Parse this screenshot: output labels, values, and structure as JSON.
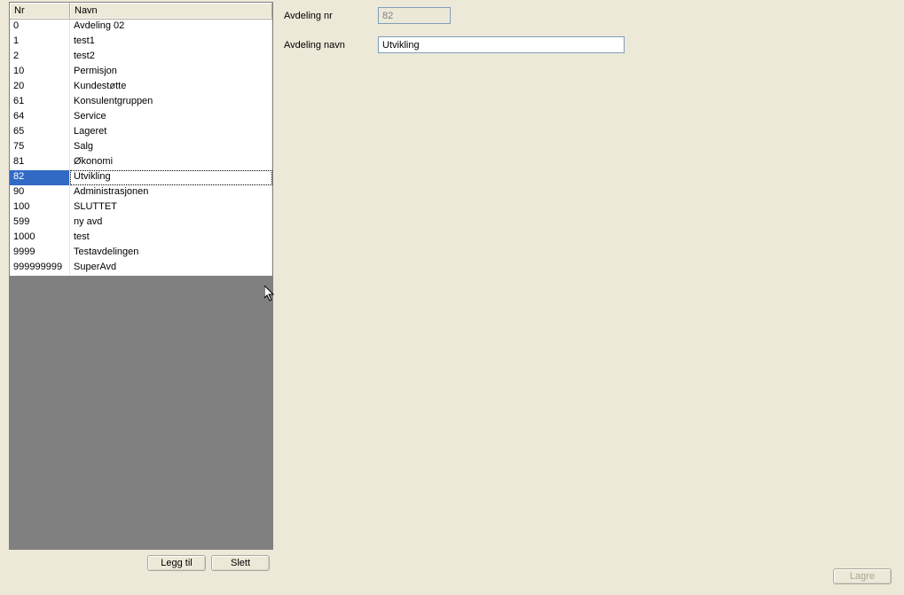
{
  "table": {
    "header_nr": "Nr",
    "header_navn": "Navn",
    "rows": [
      {
        "nr": "0",
        "navn": "Avdeling 02",
        "selected": false
      },
      {
        "nr": "1",
        "navn": "test1",
        "selected": false
      },
      {
        "nr": "2",
        "navn": "test2",
        "selected": false
      },
      {
        "nr": "10",
        "navn": "Permisjon",
        "selected": false
      },
      {
        "nr": "20",
        "navn": "Kundestøtte",
        "selected": false
      },
      {
        "nr": "61",
        "navn": "Konsulentgruppen",
        "selected": false
      },
      {
        "nr": "64",
        "navn": "Service",
        "selected": false
      },
      {
        "nr": "65",
        "navn": "Lageret",
        "selected": false
      },
      {
        "nr": "75",
        "navn": "Salg",
        "selected": false
      },
      {
        "nr": "81",
        "navn": "Økonomi",
        "selected": false
      },
      {
        "nr": "82",
        "navn": "Utvikling",
        "selected": true
      },
      {
        "nr": "90",
        "navn": "Administrasjonen",
        "selected": false
      },
      {
        "nr": "100",
        "navn": "SLUTTET",
        "selected": false
      },
      {
        "nr": "599",
        "navn": "ny avd",
        "selected": false
      },
      {
        "nr": "1000",
        "navn": "test",
        "selected": false
      },
      {
        "nr": "9999",
        "navn": "Testavdelingen",
        "selected": false
      },
      {
        "nr": "999999999",
        "navn": "SuperAvd",
        "selected": false
      }
    ]
  },
  "buttons": {
    "add": "Legg til",
    "delete": "Slett",
    "save": "Lagre"
  },
  "form": {
    "nr_label": "Avdeling nr",
    "nr_value": "82",
    "navn_label": "Avdeling navn",
    "navn_value": "Utvikling"
  }
}
